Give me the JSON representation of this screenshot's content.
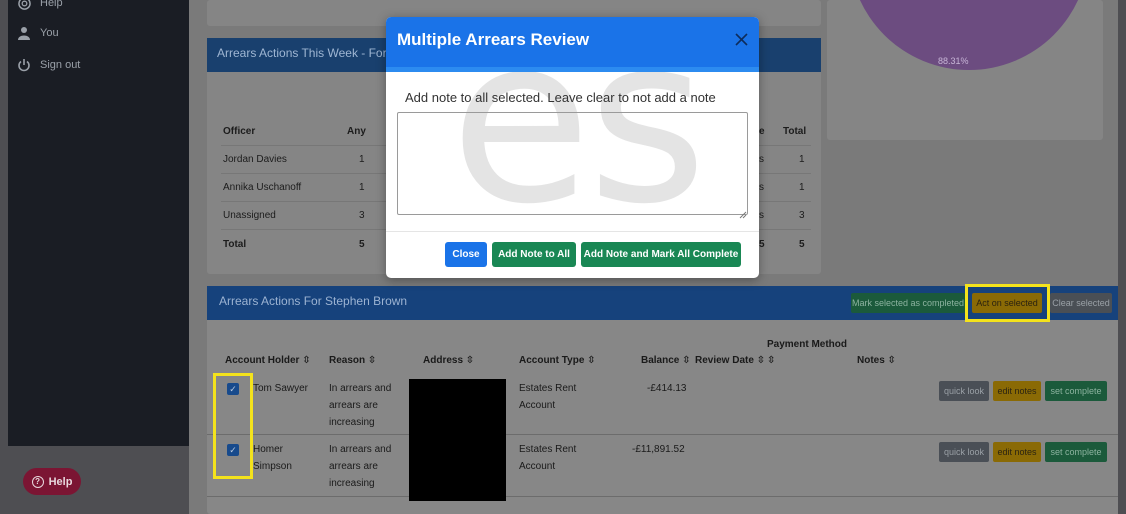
{
  "sidebar": {
    "items": [
      {
        "label": "Help",
        "icon": "help-icon"
      },
      {
        "label": "You",
        "icon": "user-icon"
      },
      {
        "label": "Sign out",
        "icon": "power-icon"
      }
    ],
    "help_button": "Help"
  },
  "pie": {
    "label": "88.31%"
  },
  "week_panel": {
    "title": "Arrears Actions This Week - For",
    "headers": {
      "officer": "Officer",
      "any": "Any",
      "e": "e",
      "total": "Total"
    },
    "rows": [
      {
        "officer": "Jordan Davies",
        "any": "1",
        "mid": "s",
        "total": "1"
      },
      {
        "officer": "Annika Uschanoff",
        "any": "1",
        "mid": "s",
        "total": "1"
      },
      {
        "officer": "Unassigned",
        "any": "3",
        "mid": "s",
        "total": "3"
      },
      {
        "officer": "Total",
        "any": "5",
        "mid": "5",
        "total": "5"
      }
    ]
  },
  "steph_panel": {
    "title": "Arrears Actions For Stephen Brown",
    "mark_completed": "Mark selected as completed",
    "act_on_selected": "Act on selected",
    "clear_selected": "Clear selected",
    "columns": {
      "account_holder": "Account Holder ⇳",
      "reason": "Reason ⇳",
      "address": "Address ⇳",
      "account_type": "Account Type ⇳",
      "balance": "Balance ⇳",
      "review_date": "Review Date ⇳",
      "payment_method": "Payment Method",
      "payment_sort": "⇳",
      "notes": "Notes ⇳"
    },
    "rows": [
      {
        "holder_line1": "Tom Sawyer",
        "holder_line2": "",
        "reason_line1": "In arrears and",
        "reason_line2": "arrears are",
        "reason_line3": "increasing",
        "type_line1": "Estates Rent",
        "type_line2": "Account",
        "balance": "-£414.13"
      },
      {
        "holder_line1": "Homer",
        "holder_line2": "Simpson",
        "reason_line1": "In arrears and",
        "reason_line2": "arrears are",
        "reason_line3": "increasing",
        "type_line1": "Estates Rent",
        "type_line2": "Account",
        "balance": "-£11,891.52"
      }
    ],
    "row_buttons": {
      "quick_look": "quick look",
      "edit_notes": "edit notes",
      "set_complete": "set complete"
    }
  },
  "modal": {
    "title": "Multiple Arrears Review",
    "watermark": "es",
    "prompt": "Add note to all selected. Leave clear to not add a note",
    "note_value": "",
    "close_button": "Close",
    "add_note_button": "Add Note to All",
    "add_note_mark_button": "Add Note and Mark All Complete"
  },
  "colors": {
    "primary": "#1a73e8",
    "success": "#198754",
    "warning_highlight": "#f4e31c",
    "sidebar": "#1a1d24"
  }
}
